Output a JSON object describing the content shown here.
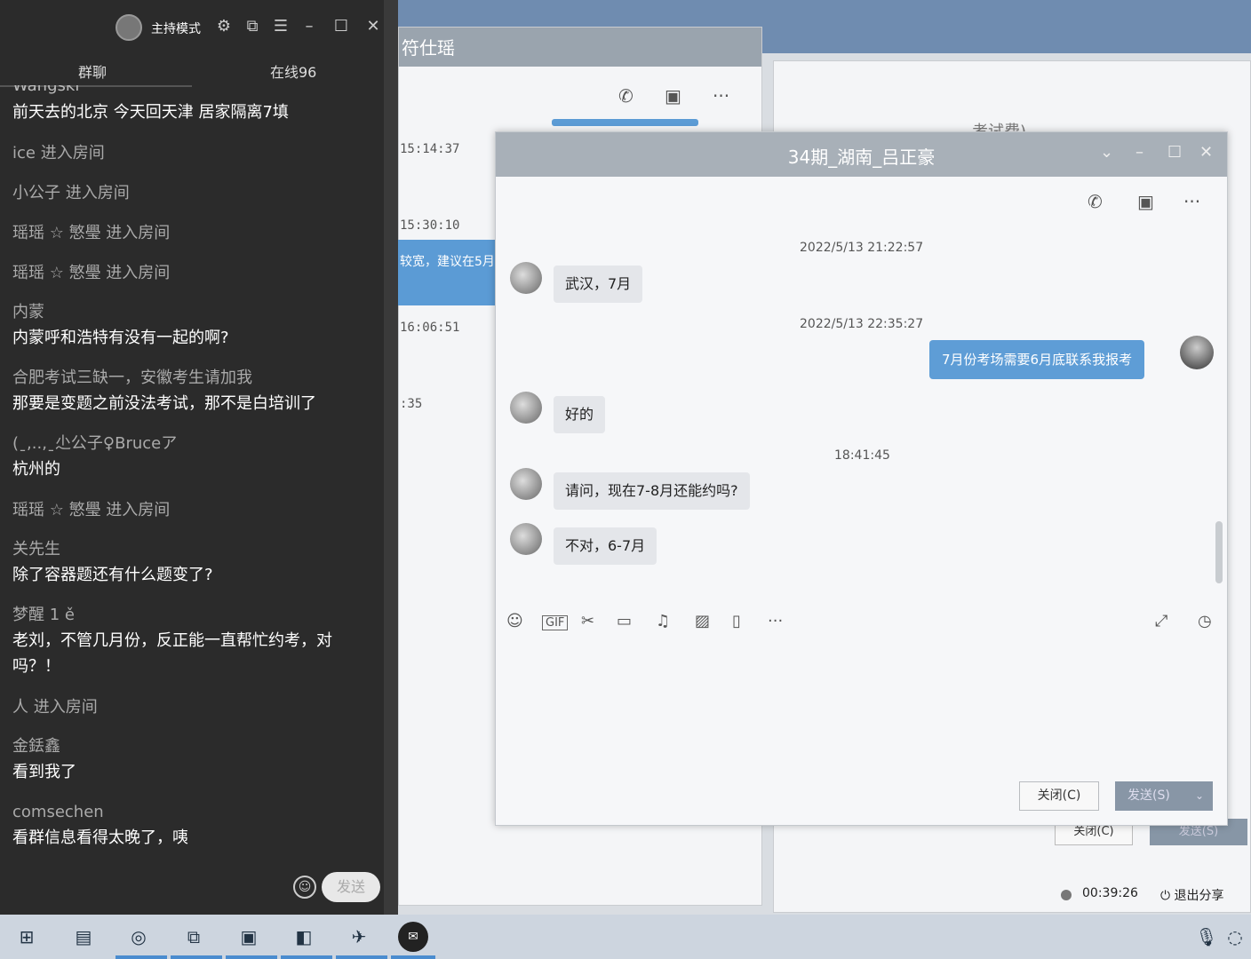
{
  "left_panel": {
    "host_mode": "主持模式",
    "tabs": [
      {
        "label": "群聊"
      },
      {
        "label": "在线96"
      }
    ],
    "cut_name": "Wangski",
    "messages": [
      {
        "type": "text",
        "text": "前天去的北京  今天回天津 居家隔离7填"
      },
      {
        "type": "system",
        "text": "ice 进入房间"
      },
      {
        "type": "system",
        "text": "小公子 进入房间"
      },
      {
        "type": "system",
        "text": "瑶瑶 ☆ 慜璺 进入房间"
      },
      {
        "type": "system",
        "text": "瑶瑶 ☆ 慜璺 进入房间"
      },
      {
        "type": "user",
        "name": "内蒙",
        "text": "内蒙呼和浩特有没有一起的啊?"
      },
      {
        "type": "user",
        "name": "合肥考试三缺一，安徽考生请加我",
        "text": "那要是变题之前没法考试，那不是白培训了"
      },
      {
        "type": "user",
        "name": "(ˍ,..,ˍ尐公子♀Bruceア",
        "text": "杭州的"
      },
      {
        "type": "system",
        "text": "瑶瑶 ☆ 慜璺 进入房间"
      },
      {
        "type": "user",
        "name": "关先生",
        "text": "除了容器题还有什么题变了?"
      },
      {
        "type": "user",
        "name": "梦醒 1 ě",
        "text": "老刘，不管几月份，反正能一直帮忙约考，对吗？！"
      },
      {
        "type": "system",
        "text": "人 进入房间"
      },
      {
        "type": "user",
        "name": "金銩鑫",
        "text": "看到我了"
      },
      {
        "type": "user",
        "name": "comsechen",
        "text": "看群信息看得太晚了，咦"
      }
    ],
    "send_label": "发送"
  },
  "background": {
    "title": "符仕瑶",
    "timestamps": [
      "15:14:37",
      "15:30:10",
      "16:06:51",
      ":35"
    ],
    "partial_blue_text": "较宽，建议在5月",
    "partial_title2": "考试费)",
    "close_label": "关闭(C)",
    "send_label": "发送(S)"
  },
  "chat_window": {
    "title": "34期_湖南_吕正豪",
    "messages": [
      {
        "type": "time",
        "text": "2022/5/13 21:22:57"
      },
      {
        "type": "in",
        "text": "武汉，7月"
      },
      {
        "type": "time",
        "text": "2022/5/13 22:35:27"
      },
      {
        "type": "out",
        "text": "7月份考场需要6月底联系我报考"
      },
      {
        "type": "in",
        "text": "好的"
      },
      {
        "type": "time",
        "text": "18:41:45"
      },
      {
        "type": "in",
        "text": "请问，现在7-8月还能约吗?"
      },
      {
        "type": "in",
        "text": "不对，6-7月"
      }
    ],
    "close_label": "关闭(C)",
    "send_label": "发送(S)"
  },
  "share_bar": {
    "timer": "00:39:26",
    "exit_label": "退出分享"
  },
  "taskbar": {
    "icons": [
      "windows-start-icon",
      "file-explorer-icon",
      "chrome-icon",
      "task-view-icon",
      "terminal-icon",
      "app-icon",
      "rocket-icon",
      "ding-icon",
      "mic-icon",
      "network-icon"
    ]
  },
  "colors": {
    "accent_blue": "#5e9dd6",
    "panel_dark": "#2b2b2b",
    "taskbar": "#cdd5df"
  }
}
